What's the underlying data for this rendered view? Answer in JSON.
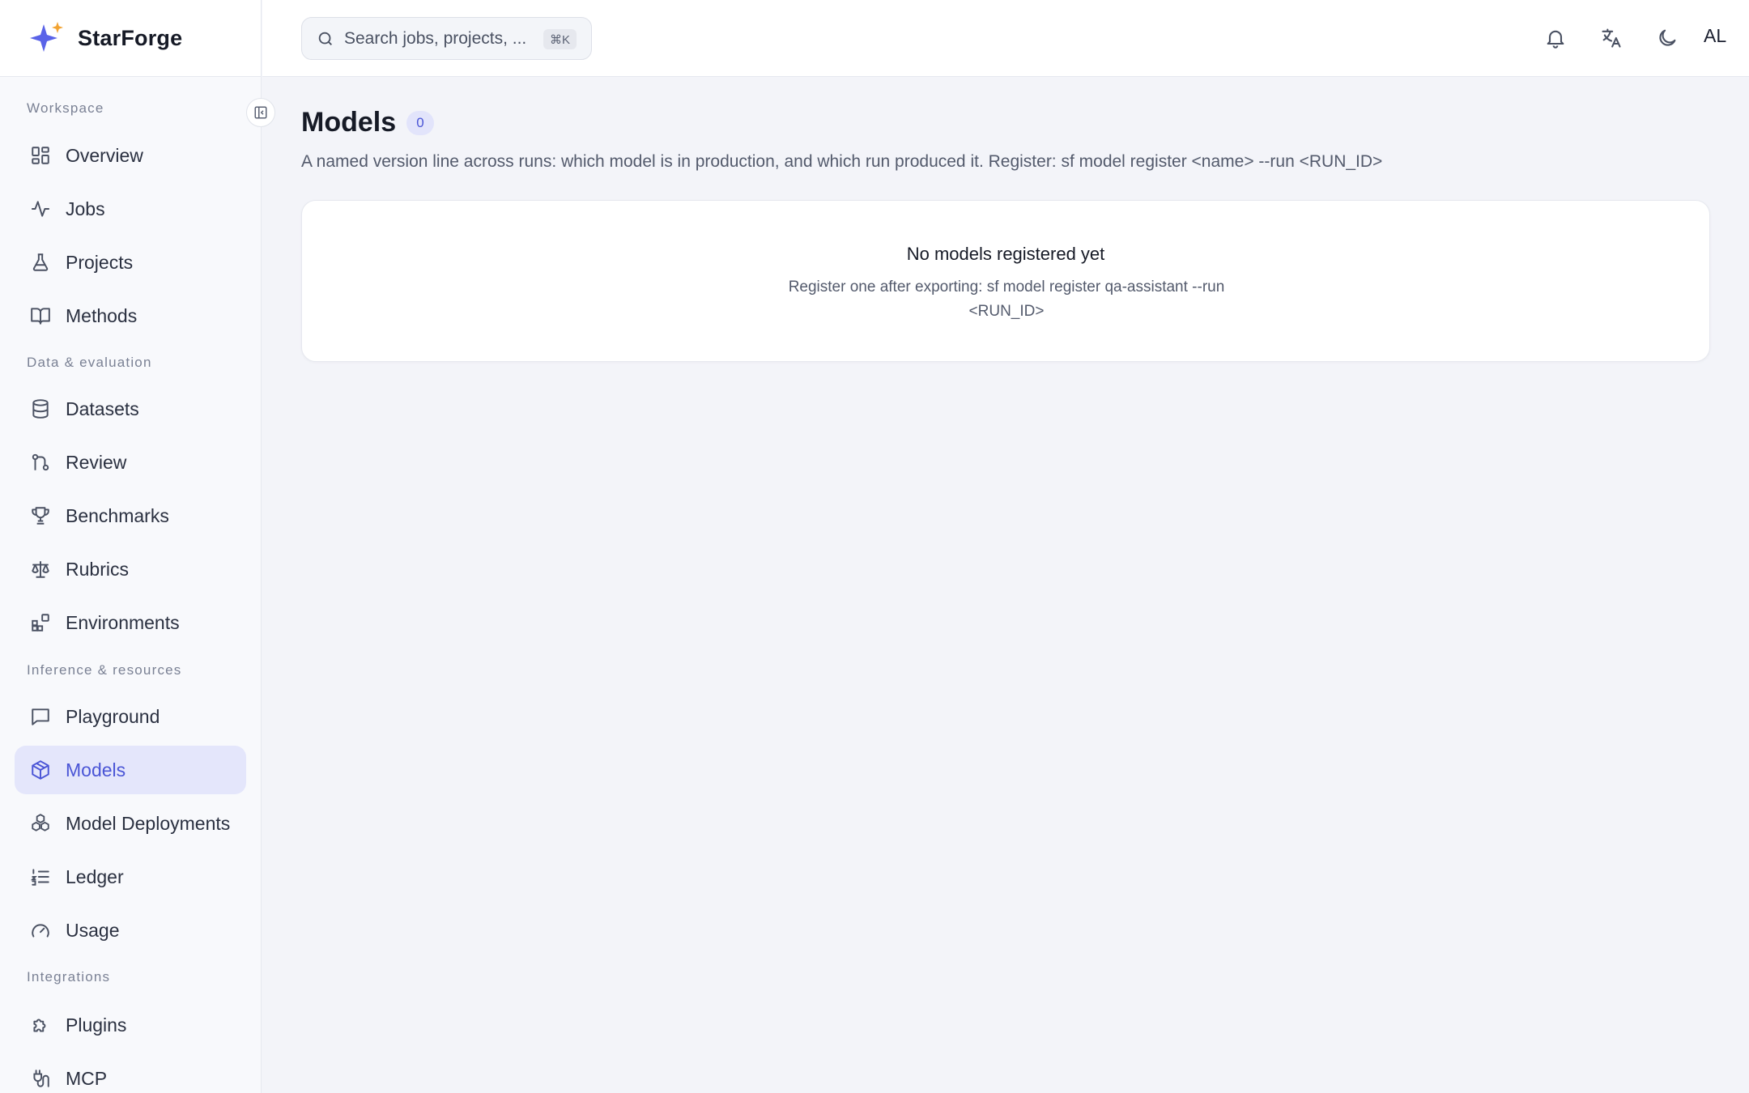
{
  "app": {
    "name": "StarForge"
  },
  "search": {
    "placeholder": "Search jobs, projects, ...",
    "shortcut": "⌘K"
  },
  "header": {
    "avatar": "AL"
  },
  "sidebar": {
    "sections": [
      {
        "label": "Workspace",
        "items": [
          {
            "label": "Overview",
            "icon": "overview-icon"
          },
          {
            "label": "Jobs",
            "icon": "activity-icon"
          },
          {
            "label": "Projects",
            "icon": "flask-icon"
          },
          {
            "label": "Methods",
            "icon": "book-icon"
          }
        ]
      },
      {
        "label": "Data & evaluation",
        "items": [
          {
            "label": "Datasets",
            "icon": "database-icon"
          },
          {
            "label": "Review",
            "icon": "git-pull-request-icon"
          },
          {
            "label": "Benchmarks",
            "icon": "trophy-icon"
          },
          {
            "label": "Rubrics",
            "icon": "scale-icon"
          },
          {
            "label": "Environments",
            "icon": "blocks-icon"
          }
        ]
      },
      {
        "label": "Inference & resources",
        "items": [
          {
            "label": "Playground",
            "icon": "message-square-icon"
          },
          {
            "label": "Models",
            "icon": "box-icon",
            "active": true
          },
          {
            "label": "Model Deployments",
            "icon": "boxes-icon"
          },
          {
            "label": "Ledger",
            "icon": "list-ordered-icon"
          },
          {
            "label": "Usage",
            "icon": "gauge-icon"
          }
        ]
      },
      {
        "label": "Integrations",
        "items": [
          {
            "label": "Plugins",
            "icon": "puzzle-icon"
          },
          {
            "label": "MCP",
            "icon": "plug-icon"
          }
        ]
      }
    ]
  },
  "main": {
    "title": "Models",
    "count": "0",
    "description": "A named version line across runs: which model is in production, and which run produced it. Register: sf model register <name> --run <RUN_ID>",
    "empty": {
      "title": "No models registered yet",
      "description": "Register one after exporting: sf model register qa-assistant --run <RUN_ID>"
    }
  },
  "colors": {
    "accent": "#4a55d6",
    "active_bg": "#e4e6fb",
    "page_bg": "#f3f4f9"
  }
}
